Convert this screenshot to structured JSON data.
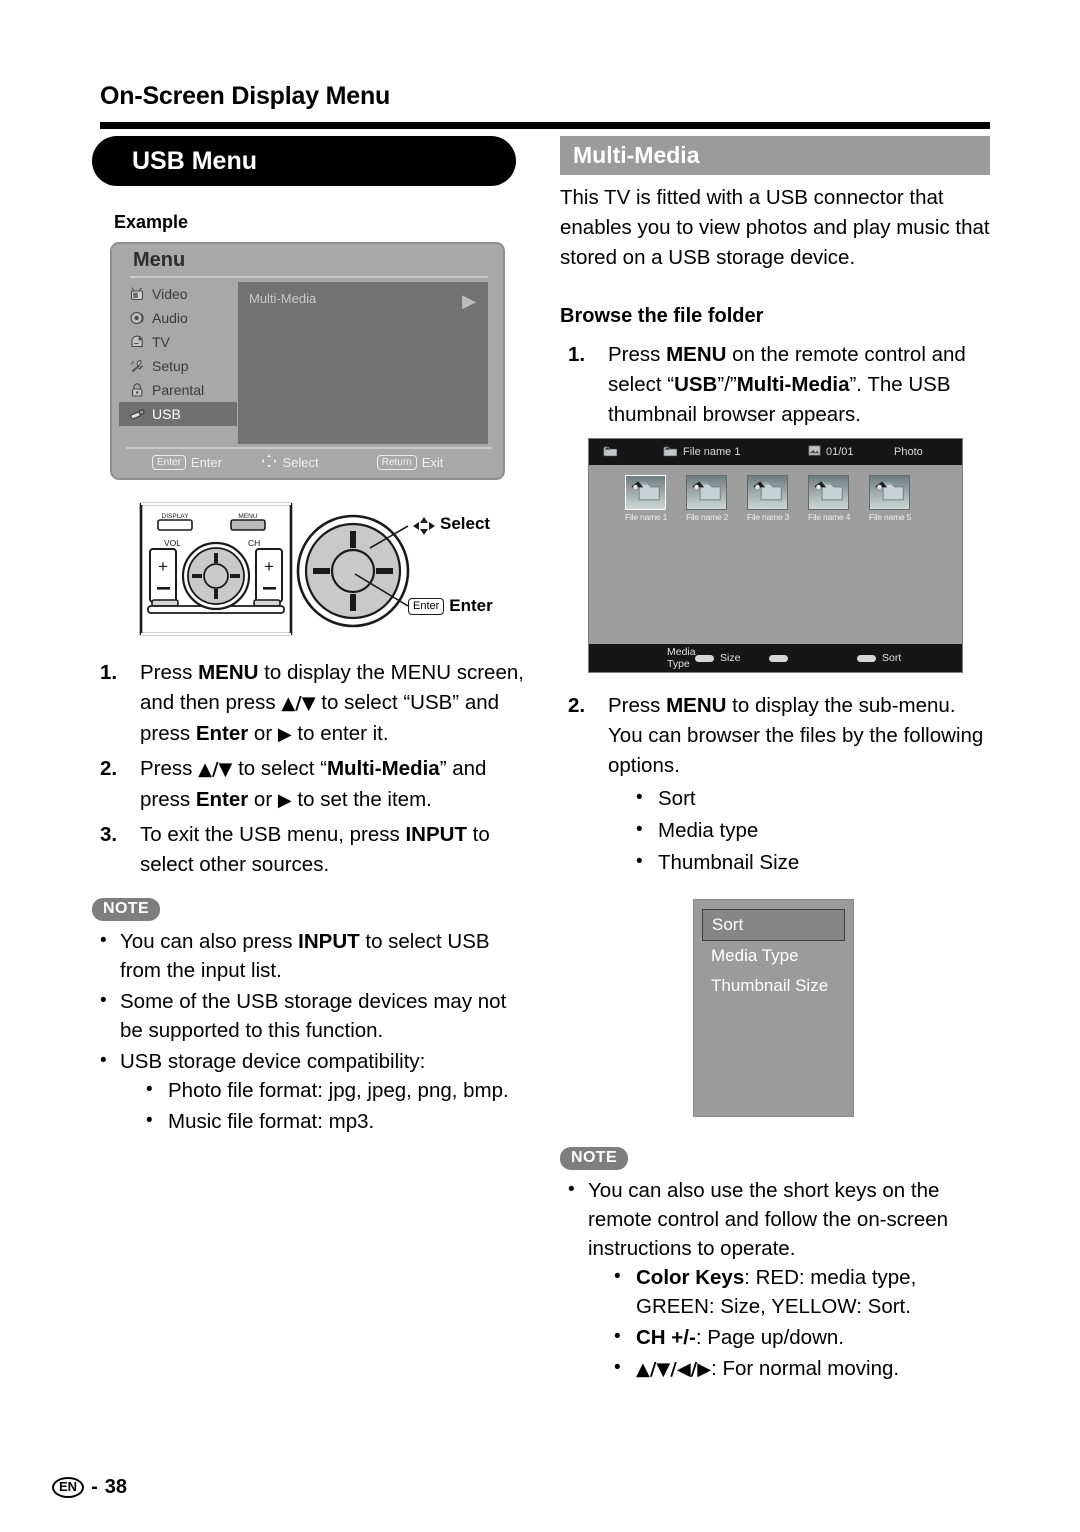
{
  "running_head": "On-Screen Display Menu",
  "footer": {
    "lang": "EN",
    "sep": "-",
    "page": "38"
  },
  "left": {
    "heading": "USB Menu",
    "example_label": "Example",
    "osd": {
      "title": "Menu",
      "side_items": [
        {
          "label": "Video",
          "icon": "tv-icon",
          "selected": false
        },
        {
          "label": "Audio",
          "icon": "speaker-icon",
          "selected": false
        },
        {
          "label": "TV",
          "icon": "antenna-icon",
          "selected": false
        },
        {
          "label": "Setup",
          "icon": "wrench-icon",
          "selected": false
        },
        {
          "label": "Parental",
          "icon": "lock-icon",
          "selected": false
        },
        {
          "label": "USB",
          "icon": "usb-icon",
          "selected": true
        }
      ],
      "pane_item": "Multi-Media",
      "pane_arrow": "▶",
      "footer_hints": [
        {
          "key": "Enter",
          "label": "Enter"
        },
        {
          "key": "",
          "label": "Select"
        },
        {
          "key": "Return",
          "label": "Exit"
        }
      ]
    },
    "remote": {
      "display_label": "DISPLAY",
      "menu_label": "MENU",
      "vol_label": "VOL",
      "ch_label": "CH",
      "plus": "+",
      "minus": "−",
      "callout_select": "Select",
      "callout_enter_key": "Enter",
      "callout_enter": "Enter"
    },
    "steps": [
      {
        "num": "1.",
        "html": "Press <b>MENU</b> to display the MENU screen, and then press <b class=\"arrglyph\">▲/▼</b> to select “USB” and press <b>Enter</b> or <span class=\"arrglyph\">▶</span> to enter it."
      },
      {
        "num": "2.",
        "html": "Press <b class=\"arrglyph\">▲/▼</b> to select “<b>Multi-Media</b>” and press <b>Enter</b> or <span class=\"arrglyph\">▶</span> to set the item."
      },
      {
        "num": "3.",
        "html": "To exit the USB menu, press <b>INPUT</b> to select other sources."
      }
    ],
    "note_tag": "NOTE",
    "notes": [
      {
        "html": "You can also press <b>INPUT</b> to select USB from the input list."
      },
      {
        "html": "Some of the USB storage devices may not be supported to this function."
      },
      {
        "html": "USB storage device compatibility:",
        "sub": [
          {
            "html": "Photo file format: jpg, jpeg, png, bmp."
          },
          {
            "html": "Music file format: mp3."
          }
        ]
      }
    ]
  },
  "right": {
    "heading": "Multi-Media",
    "intro": "This TV is fitted with a USB connector that enables you to view photos and play music that stored on a USB storage device.",
    "sub_heading": "Browse the file folder",
    "step1": {
      "num": "1.",
      "html": "Press <b>MENU</b> on the remote control and select “<b>USB</b>”/”<b>Multi-Media</b>”. The USB thumbnail browser appears."
    },
    "browser": {
      "top": {
        "folder_icon": "folder-photo-icon",
        "current_folder": "File name 1",
        "counter_icon": "photo-count-icon",
        "counter": "01/01",
        "media_type": "Photo"
      },
      "thumbnails": [
        {
          "caption": "File name 1",
          "selected": true
        },
        {
          "caption": "File name 2",
          "selected": false
        },
        {
          "caption": "File name 3",
          "selected": false
        },
        {
          "caption": "File name 4",
          "selected": false
        },
        {
          "caption": "File name 5",
          "selected": false
        }
      ],
      "bottom_keys": [
        {
          "label": "Media Type",
          "color": "#d6d6d6"
        },
        {
          "label": "Size",
          "color": "#d6d6d6"
        },
        {
          "label": "",
          "color": "#d6d6d6"
        },
        {
          "label": "Sort",
          "color": "#d6d6d6"
        }
      ]
    },
    "step2": {
      "num": "2.",
      "html": "Press <b>MENU</b> to display the sub-menu. You can browser the files by the following options."
    },
    "step2_options": [
      "Sort",
      "Media type",
      "Thumbnail Size"
    ],
    "submenu": {
      "items": [
        {
          "label": "Sort",
          "selected": true
        },
        {
          "label": "Media Type",
          "selected": false
        },
        {
          "label": "Thumbnail Size",
          "selected": false
        }
      ]
    },
    "note_tag": "NOTE",
    "notes": [
      {
        "html": "You can also use the short keys on the remote control and follow the on-screen instructions to operate.",
        "sub": [
          {
            "html": "<b>Color Keys</b>: RED: media type, GREEN: Size, YELLOW: Sort."
          },
          {
            "html": "<b>CH +/-</b>: Page up/down."
          },
          {
            "html": "<b class=\"arrglyph\">▲/▼/◀/▶</b>: For normal moving."
          }
        ]
      }
    ]
  }
}
